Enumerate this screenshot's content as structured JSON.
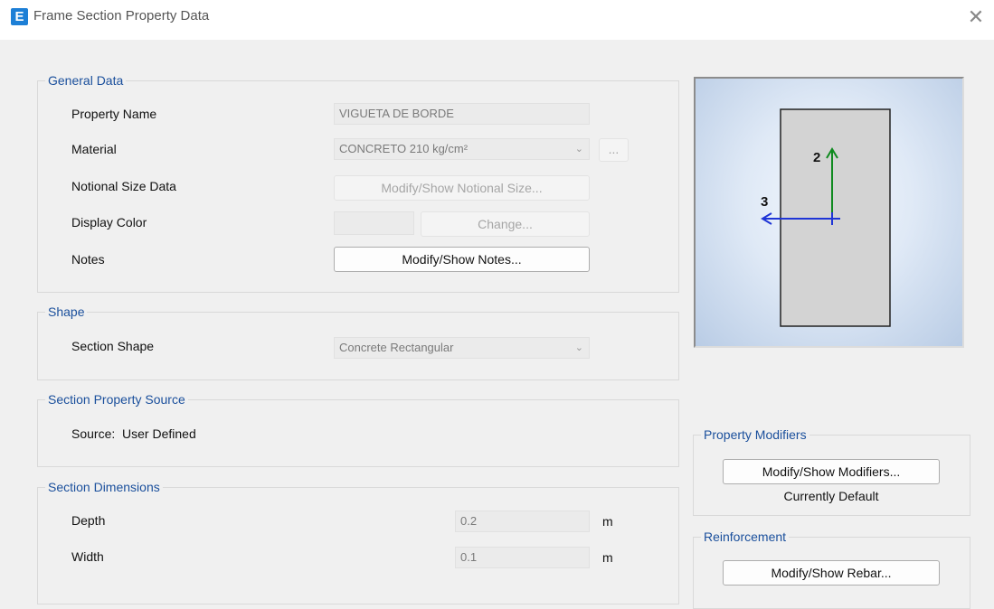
{
  "window": {
    "title": "Frame Section Property Data",
    "app_icon_letter": "E",
    "close_glyph": "✕"
  },
  "general_data": {
    "title": "General Data",
    "property_name_label": "Property Name",
    "property_name_value": "VIGUETA DE BORDE",
    "material_label": "Material",
    "material_value": "CONCRETO 210 kg/cm²",
    "material_browse_label": "...",
    "notional_label": "Notional Size Data",
    "notional_button": "Modify/Show Notional Size...",
    "color_label": "Display Color",
    "color_button": "Change...",
    "notes_label": "Notes",
    "notes_button": "Modify/Show Notes..."
  },
  "shape": {
    "title": "Shape",
    "section_shape_label": "Section Shape",
    "section_shape_value": "Concrete Rectangular"
  },
  "source": {
    "title": "Section Property Source",
    "text": "Source:  User Defined"
  },
  "dimensions": {
    "title": "Section Dimensions",
    "depth_label": "Depth",
    "depth_value": "0.2",
    "depth_unit": "m",
    "width_label": "Width",
    "width_value": "0.1",
    "width_unit": "m"
  },
  "preview": {
    "axis_2_label": "2",
    "axis_3_label": "3",
    "axis_2_color": "#0f8a1f",
    "axis_3_color": "#1f35d6"
  },
  "property_modifiers": {
    "title": "Property Modifiers",
    "button": "Modify/Show Modifiers...",
    "status": "Currently Default"
  },
  "reinforcement": {
    "title": "Reinforcement",
    "button": "Modify/Show Rebar..."
  }
}
